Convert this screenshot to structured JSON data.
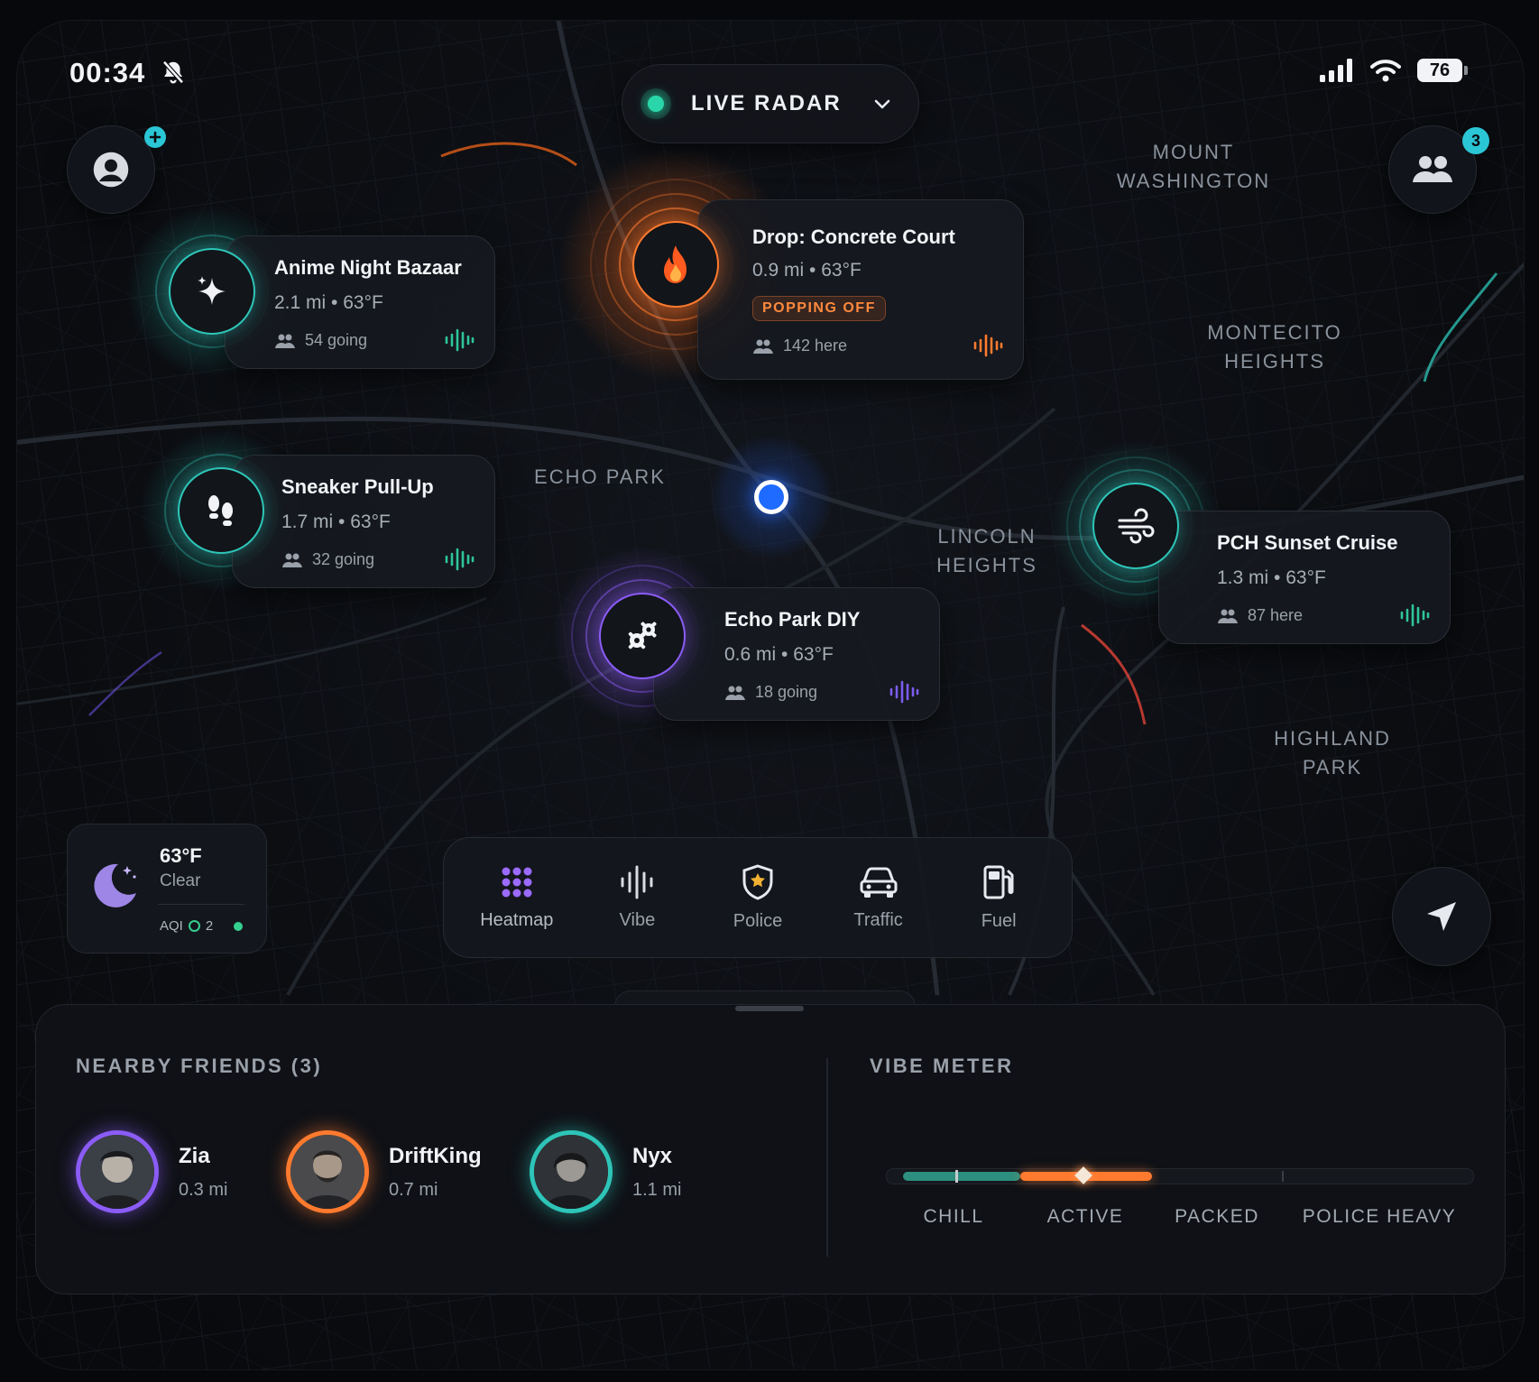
{
  "status_bar": {
    "time": "00:34",
    "battery": "76"
  },
  "header": {
    "mode_label": "LIVE RADAR",
    "friends_badge": "3"
  },
  "districts": [
    {
      "id": "mount-washington",
      "line1": "MOUNT",
      "line2": "WASHINGTON"
    },
    {
      "id": "montecito-heights",
      "line1": "MONTECITO",
      "line2": "HEIGHTS"
    },
    {
      "id": "echo-park",
      "line1": "ECHO PARK",
      "line2": ""
    },
    {
      "id": "lincoln-heights",
      "line1": "LINCOLN",
      "line2": "HEIGHTS"
    },
    {
      "id": "highland-park",
      "line1": "HIGHLAND",
      "line2": "PARK"
    }
  ],
  "events": [
    {
      "title": "Anime Night Bazaar",
      "meta": "2.1 mi • 63°F",
      "count": "54 going",
      "icon": "sparkle-icon",
      "color": "#2ec5b8"
    },
    {
      "title": "Drop: Concrete Court",
      "meta": "0.9 mi • 63°F",
      "badge": "POPPING OFF",
      "count": "142 here",
      "icon": "fire-icon",
      "color": "#ff7a2e"
    },
    {
      "title": "Sneaker Pull-Up",
      "meta": "1.7 mi • 63°F",
      "count": "32 going",
      "icon": "footprints-icon",
      "color": "#2ec5b8"
    },
    {
      "title": "PCH Sunset Cruise",
      "meta": "1.3 mi • 63°F",
      "count": "87 here",
      "icon": "wind-icon",
      "color": "#2ec5b8"
    },
    {
      "title": "Echo Park DIY",
      "meta": "0.6 mi • 63°F",
      "count": "18 going",
      "icon": "gears-icon",
      "color": "#8b5cf6"
    }
  ],
  "weather": {
    "temp": "63°F",
    "condition": "Clear",
    "aqi_label": "AQI",
    "aqi_value": "2",
    "icon": "moon-icon"
  },
  "toolbar": [
    {
      "label": "Heatmap",
      "icon": "heatmap-icon",
      "color": "#9b6bff"
    },
    {
      "label": "Vibe",
      "icon": "vibe-icon"
    },
    {
      "label": "Police",
      "icon": "police-shield-icon"
    },
    {
      "label": "Traffic",
      "icon": "car-icon"
    },
    {
      "label": "Fuel",
      "icon": "fuel-icon"
    }
  ],
  "friends_section": {
    "title": "NEARBY FRIENDS (3)",
    "friends": [
      {
        "name": "Zia",
        "distance": "0.3 mi",
        "ring_color": "#8b5cf6"
      },
      {
        "name": "DriftKing",
        "distance": "0.7 mi",
        "ring_color": "#ff7a2e"
      },
      {
        "name": "Nyx",
        "distance": "1.1 mi",
        "ring_color": "#2ec5b8"
      }
    ]
  },
  "vibe_meter": {
    "title": "VIBE METER",
    "levels": [
      "CHILL",
      "ACTIVE",
      "PACKED",
      "POLICE HEAVY"
    ],
    "current": "ACTIVE",
    "colors": {
      "chill": "#2c8f7f",
      "active": "#ff7a2e"
    }
  }
}
